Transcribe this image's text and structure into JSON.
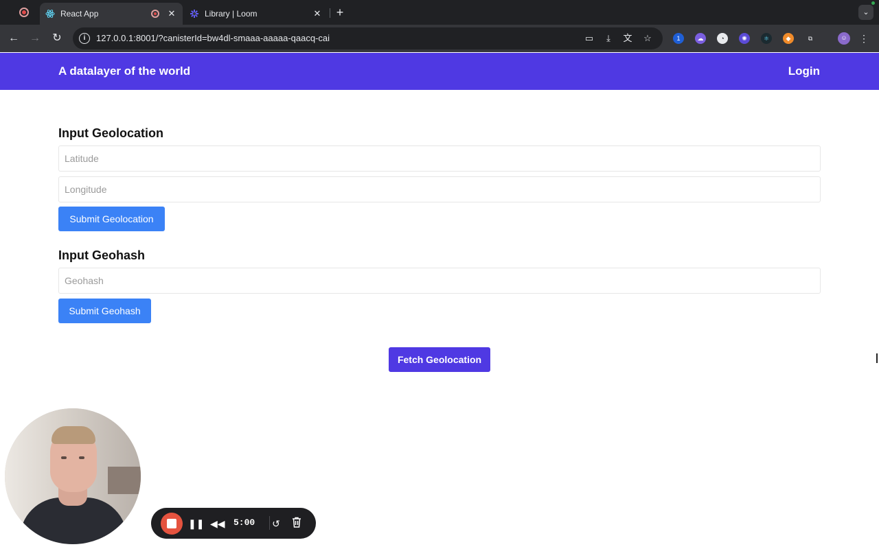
{
  "browser": {
    "tabs": [
      {
        "title": "React App",
        "active": true
      },
      {
        "title": "Library | Loom",
        "active": false
      }
    ],
    "close_glyph": "✕",
    "new_tab_glyph": "+",
    "url": "127.0.0.1:8001/?canisterId=bw4dl-smaaa-aaaaa-qaacq-cai"
  },
  "app": {
    "brand": "A datalayer of the world",
    "login_label": "Login",
    "accent_color": "#4f39e3",
    "button_blue": "#3b82f6"
  },
  "geolocation_section": {
    "title": "Input Geolocation",
    "latitude_placeholder": "Latitude",
    "latitude_value": "",
    "longitude_placeholder": "Longitude",
    "longitude_value": "",
    "submit_label": "Submit Geolocation"
  },
  "geohash_section": {
    "title": "Input Geohash",
    "geohash_placeholder": "Geohash",
    "geohash_value": "",
    "submit_label": "Submit Geohash"
  },
  "fetch_label": "Fetch Geolocation",
  "loom": {
    "timer": "5:00",
    "icons": [
      "stop-icon",
      "pause-icon",
      "rewind-icon",
      "restart-icon",
      "trash-icon"
    ]
  }
}
